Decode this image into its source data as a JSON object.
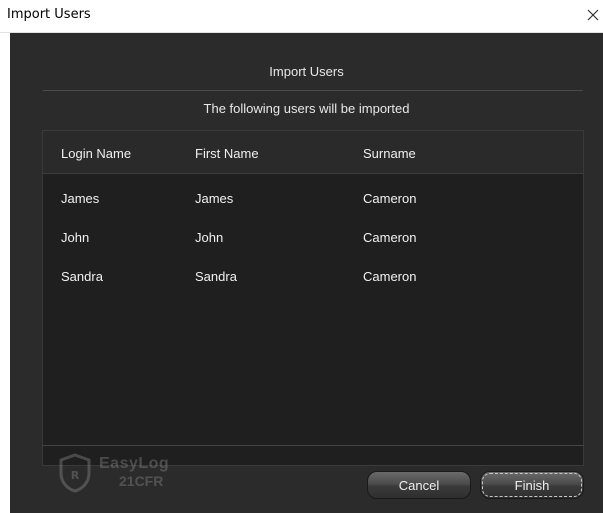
{
  "window": {
    "title": "Import Users",
    "close_icon": "close-icon"
  },
  "dialog": {
    "header": "Import Users",
    "subtitle": "The following users will be imported"
  },
  "table": {
    "columns": [
      "Login Name",
      "First Name",
      "Surname"
    ],
    "rows": [
      [
        "James",
        "James",
        "Cameron"
      ],
      [
        "John",
        "John",
        "Cameron"
      ],
      [
        "Sandra",
        "Sandra",
        "Cameron"
      ]
    ]
  },
  "logo": {
    "brand": "EasyLog",
    "sub": "21CFR",
    "icon": "shield-logo-icon"
  },
  "buttons": {
    "cancel": "Cancel",
    "finish": "Finish"
  },
  "colors": {
    "background": "#2b2b2b",
    "table_bg": "#1f1f1f",
    "text": "#f0f0f0"
  }
}
